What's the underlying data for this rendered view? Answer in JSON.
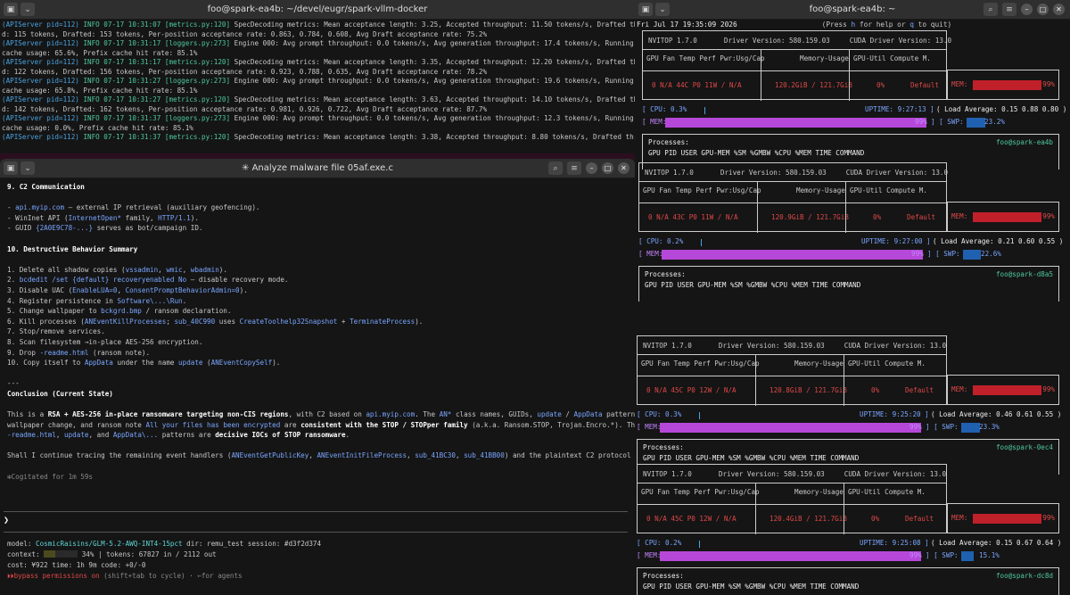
{
  "top_term": {
    "title": "foo@spark-ea4b: ~/devel/eugr/spark-vllm-docker",
    "lines": [
      [
        "(APIServer pid=112)",
        "INFO 07-17 10:31:07 [metrics.py:120]",
        "SpecDecoding metrics: Mean acceptance length: 3.25, Accepted throughput: 11.50 tokens/s, Drafted throughput: 15.30 tokens/s, Accepte"
      ],
      [
        "",
        "",
        "d: 115 tokens, Drafted: 153 tokens, Per-position acceptance rate: 0.863, 0.784, 0.608, Avg Draft acceptance rate: 75.2%"
      ],
      [
        "(APIServer pid=112)",
        "INFO 07-17 10:31:17 [loggers.py:273]",
        "Engine 000: Avg prompt throughput: 0.0 tokens/s, Avg generation throughput: 17.4 tokens/s, Running: 1 reqs, Waiting: 0 reqs, GPU KV"
      ],
      [
        "",
        "",
        "cache usage: 65.6%, Prefix cache hit rate: 85.1%"
      ],
      [
        "(APIServer pid=112)",
        "INFO 07-17 10:31:17 [metrics.py:120]",
        "SpecDecoding metrics: Mean acceptance length: 3.35, Accepted throughput: 12.20 tokens/s, Drafted throughput: 15.60 tokens/s, Accepte"
      ],
      [
        "",
        "",
        "d: 122 tokens, Drafted: 156 tokens, Per-position acceptance rate: 0.923, 0.788, 0.635, Avg Draft acceptance rate: 78.2%"
      ],
      [
        "(APIServer pid=112)",
        "INFO 07-17 10:31:27 [loggers.py:273]",
        "Engine 000: Avg prompt throughput: 0.0 tokens/s, Avg generation throughput: 19.6 tokens/s, Running: 1 reqs, Waiting: 0 reqs, GPU KV"
      ],
      [
        "",
        "",
        "cache usage: 65.8%, Prefix cache hit rate: 85.1%"
      ],
      [
        "(APIServer pid=112)",
        "INFO 07-17 10:31:27 [metrics.py:120]",
        "SpecDecoding metrics: Mean acceptance length: 3.63, Accepted throughput: 14.10 tokens/s, Drafted throughput: 16.10 tokens/s, Accepte"
      ],
      [
        "",
        "",
        "d: 142 tokens, Drafted: 162 tokens, Per-position acceptance rate: 0.981, 0.926, 0.722, Avg Draft acceptance rate: 87.7%"
      ],
      [
        "(APIServer pid=112)",
        "INFO 07-17 10:31:37 [loggers.py:273]",
        "Engine 000: Avg prompt throughput: 0.0 tokens/s, Avg generation throughput: 12.3 tokens/s, Running: 0 reqs, Waiting: 0 reqs, GPU KV"
      ],
      [
        "",
        "",
        "cache usage: 0.0%, Prefix cache hit rate: 85.1%"
      ],
      [
        "(APIServer pid=112)",
        "INFO 07-17 10:31:37 [metrics.py:120]",
        "SpecDecoding metrics: Mean acceptance length: 3.38, Accepted throughput: 8.80 tokens/s, Drafted throughput: 11.10 tokens/s, Accepted"
      ]
    ]
  },
  "agent": {
    "title": "✳ Analyze malware file 05af.exe.c",
    "s9": "9. C2 Communication",
    "c2": [
      {
        "p": "- ",
        "c": "api.myip.com",
        "s": " — external IP retrieval (auxiliary geofencing)."
      },
      {
        "p": "- WinInet API (",
        "c": "InternetOpen*",
        "s": " family, ",
        "c2": "HTTP/1.1",
        "s2": ")."
      },
      {
        "p": "- GUID ",
        "c": "{2A0E9C78-...}",
        "s": " serves as bot/campaign ID."
      }
    ],
    "s10": "10. Destructive Behavior Summary",
    "items": [
      {
        "p": "1. Delete all shadow copies (",
        "c": "vssadmin",
        "s": ", ",
        "c2": "wmic",
        "s2": ", ",
        "c3": "wbadmin",
        "s3": ")."
      },
      {
        "p": "2. ",
        "c": "bcdedit /set {default} recoveryenabled No",
        "s": " — disable recovery mode."
      },
      {
        "p": "3. Disable UAC (",
        "c": "EnableLUA=0",
        "s": ", ",
        "c2": "ConsentPromptBehaviorAdmin=0",
        "s2": ")."
      },
      {
        "p": "4. Register persistence in ",
        "c": "Software\\...\\Run",
        "s": "."
      },
      {
        "p": "5. Change wallpaper to ",
        "c": "bckgrd.bmp",
        "s": " / ransom declaration."
      },
      {
        "p": "6. Kill processes (",
        "c": "ANEventKillProcesses",
        "s": "; ",
        "c2": "sub_40C990",
        "s2": " uses ",
        "c3": "CreateToolhelp32Snapshot",
        "s3": " + ",
        "c4": "TerminateProcess",
        "s4": ")."
      },
      {
        "p": "7. Stop/remove services.",
        "c": "",
        "s": ""
      },
      {
        "p": "8. Scan filesystem →in-place AES-256 encryption.",
        "c": "",
        "s": ""
      },
      {
        "p": "9. Drop ",
        "c": "-readme.html",
        "s": " (ransom note)."
      },
      {
        "p": "10. Copy itself to ",
        "c": "AppData",
        "s": " under the name ",
        "c2": "update",
        "s2": " (",
        "c3": "ANEventCopySelf",
        "s3": ")."
      }
    ],
    "sep": "---",
    "concl_h": "Conclusion (Current State)",
    "concl1": "This is a ",
    "concl1b": "RSA + AES-256 in-place ransomware targeting non-CIS regions",
    "concl1c": ", with C2 based on ",
    "concl1d": "api.myip.com",
    "concl1e": ". The ",
    "concl1f": "AN*",
    "concl1g": " class names, GUIDs, ",
    "concl1h": "update",
    "concl1i": " / ",
    "concl1j": "AppData",
    "concl1k": " pattern,",
    "concl2a": "wallpaper change, and ransom note ",
    "concl2b": "All your files has been encrypted",
    "concl2c": " are ",
    "concl2d": "consistent with the STOP / STOPper family",
    "concl2e": " (a.k.a. Ransom.STOP, Trojan.Encro.*). The",
    "concl3a": "-readme.html",
    "concl3b": ", ",
    "concl3c": "update",
    "concl3d": ", and ",
    "concl3e": "AppData\\...",
    "concl3f": " patterns are ",
    "concl3g": "decisive IOCs of STOP ransomware",
    "concl3h": ".",
    "q1": "Shall I continue tracing the remaining event handlers (",
    "q2": "ANEventGetPublicKey",
    "q3": ", ",
    "q4": "ANEventInitFileProcess",
    "q5": ", ",
    "q6": "sub_41BC30",
    "q7": ", ",
    "q8": "sub_41BB00",
    "q9": ") and the plaintext C2 protocol details?",
    "cog": "✻Cogitated for 1m 59s",
    "prompt": "❯",
    "st1a": "model: ",
    "st1b": "CosmicRaisins/GLM-5.2-AWQ-INT4-15pct",
    "st1c": " dir: remu_test session: ",
    "st1d": "#d3f2d374",
    "st2a": "context: ",
    "st2b": " 34% | tokens: 67827 in / 2112 out",
    "st3": "cost: ¥922 time: 1h 9m code: +0/-0",
    "st4a": "⏵⏵",
    "st4b": "bypass permissions on",
    "st4c": " (shift+tab to cycle) · ←for agents",
    "ctx_pct": 34
  },
  "nvtop_title": "foo@spark-ea4b: ~",
  "nvtop_time": "Fri Jul 17 19:35:09 2026",
  "nvtop_help_a": "(Press ",
  "nvtop_help_h": "h",
  "nvtop_help_b": " for help or ",
  "nvtop_help_q": "q",
  "nvtop_help_c": " to quit)",
  "nv_hdr": {
    "ver": "NVITOP 1.7.0",
    "drv": "Driver Version: 580.159.03",
    "cuda": "CUDA Driver Version: 13.0",
    "c1": "GPU Fan Temp Perf Pwr:Usg/Cap",
    "c2": "Memory-Usage",
    "c3": "GPU-Util  Compute M.",
    "proc": "Processes:",
    "pcols": "GPU     PID      USER  GPU-MEM %SM %GMBW  %CPU  %MEM      TIME  COMMAND",
    "mem": "MEM:",
    "cpu": "CPU:",
    "mem2": "MEM:",
    "swp": "SWP:",
    "uptime_l": "UPTIME:",
    "load_l": "( Load Average:"
  },
  "nodes": [
    {
      "host": "foo@spark-ea4b",
      "gpu": "0 N/A  44C  P0    11W / N/A",
      "mem": "120.2GiB / 121.7GiB",
      "util": "0%",
      "cm": "Default",
      "mempct": "99%",
      "memfill": 0.99,
      "cpu": "0.3%",
      "cpufill": 0.003,
      "uptime": "9:27:13",
      "load": "0.15  0.88  0.80 )",
      "mem2": "99%",
      "mem2fill": 0.99,
      "swp": "23.2%",
      "swpfill": 0.232
    },
    {
      "host": "foo@spark-d8a5",
      "gpu": "0 N/A  43C  P0    11W / N/A",
      "mem": "120.9GiB / 121.7GiB",
      "util": "0%",
      "cm": "Default",
      "mempct": "99%",
      "memfill": 0.99,
      "cpu": "0.2%",
      "cpufill": 0.002,
      "uptime": "9:27:00",
      "load": "0.21  0.60  0.55 )",
      "mem2": "99%",
      "mem2fill": 0.99,
      "swp": "22.6%",
      "swpfill": 0.226
    },
    {
      "host": "foo@spark-0ec4",
      "gpu": "0 N/A  45C  P0    12W / N/A",
      "mem": "120.8GiB / 121.7GiB",
      "util": "0%",
      "cm": "Default",
      "mempct": "99%",
      "memfill": 0.99,
      "cpu": "0.3%",
      "cpufill": 0.003,
      "uptime": "9:25:20",
      "load": "0.46  0.61  0.55 )",
      "mem2": "99%",
      "mem2fill": 0.99,
      "swp": "23.3%",
      "swpfill": 0.233
    },
    {
      "host": "foo@spark-dc8d",
      "gpu": "0 N/A  45C  P0    12W / N/A",
      "mem": "120.4GiB / 121.7GiB",
      "util": "0%",
      "cm": "Default",
      "mempct": "99%",
      "memfill": 0.99,
      "cpu": "0.2%",
      "cpufill": 0.002,
      "uptime": "9:25:08",
      "load": "0.15  0.67  0.64 )",
      "mem2": "99%",
      "mem2fill": 0.99,
      "swp": "15.1%",
      "swpfill": 0.151
    }
  ]
}
